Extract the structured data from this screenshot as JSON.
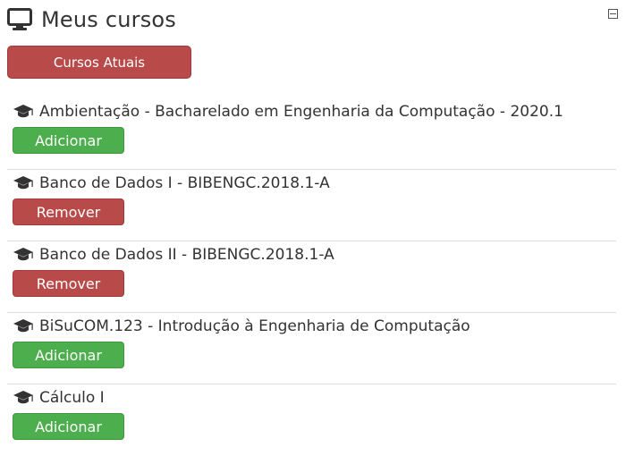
{
  "block": {
    "title": "Meus cursos",
    "icon": "monitor-icon",
    "collapse_icon": "minus-box-icon",
    "tab_label": "Cursos Atuais"
  },
  "colors": {
    "add": "#4cae4c",
    "remove": "#b84a4a",
    "text": "#333333"
  },
  "courses": [
    {
      "name": "Ambientação - Bacharelado em Engenharia da Computação - 2020.1",
      "action": "Adicionar",
      "kind": "add"
    },
    {
      "name": "Banco de Dados I - BIBENGC.2018.1-A",
      "action": "Remover",
      "kind": "remove"
    },
    {
      "name": "Banco de Dados II - BIBENGC.2018.1-A",
      "action": "Remover",
      "kind": "remove"
    },
    {
      "name": "BiSuCOM.123 - Introdução à Engenharia de Computação",
      "action": "Adicionar",
      "kind": "add"
    },
    {
      "name": "Cálculo I",
      "action": "Adicionar",
      "kind": "add"
    }
  ]
}
